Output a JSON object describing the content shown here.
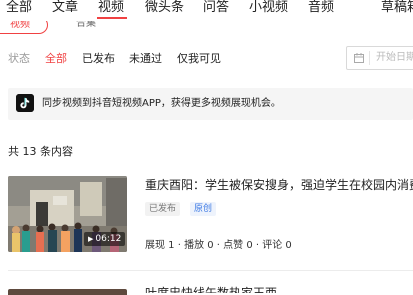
{
  "tabs": [
    {
      "label": "全部",
      "active": false
    },
    {
      "label": "文章",
      "active": false
    },
    {
      "label": "视频",
      "active": true
    },
    {
      "label": "微头条",
      "active": false
    },
    {
      "label": "问答",
      "active": false
    },
    {
      "label": "小视频",
      "active": false
    },
    {
      "label": "音频",
      "active": false
    },
    {
      "label": "草稿箱",
      "active": false
    }
  ],
  "subtabs": [
    {
      "label": "视频",
      "active": true
    },
    {
      "label": "合集",
      "active": false
    }
  ],
  "filters": {
    "label": "状态",
    "options": [
      {
        "label": "全部",
        "active": true
      },
      {
        "label": "已发布",
        "active": false
      },
      {
        "label": "未通过",
        "active": false
      },
      {
        "label": "仅我可见",
        "active": false
      }
    ]
  },
  "date": {
    "placeholder": "开始日期"
  },
  "banner": {
    "text": "同步视频到抖音短视频APP，获得更多视频展现机会。"
  },
  "summary": {
    "count_text": "共 13 条内容"
  },
  "items": [
    {
      "title": "重庆酉阳：学生被保安搜身，强迫学生在校园内消费",
      "status": "已发布",
      "badge": "原创",
      "duration": "06:12",
      "stats": "展现 1 · 播放 0 · 点赞 0 · 评论 0"
    },
    {
      "title": "叶席忠快线午数热家玉西"
    }
  ],
  "colors": {
    "accent": "#f04142",
    "original_badge": "#3d7ae4"
  }
}
